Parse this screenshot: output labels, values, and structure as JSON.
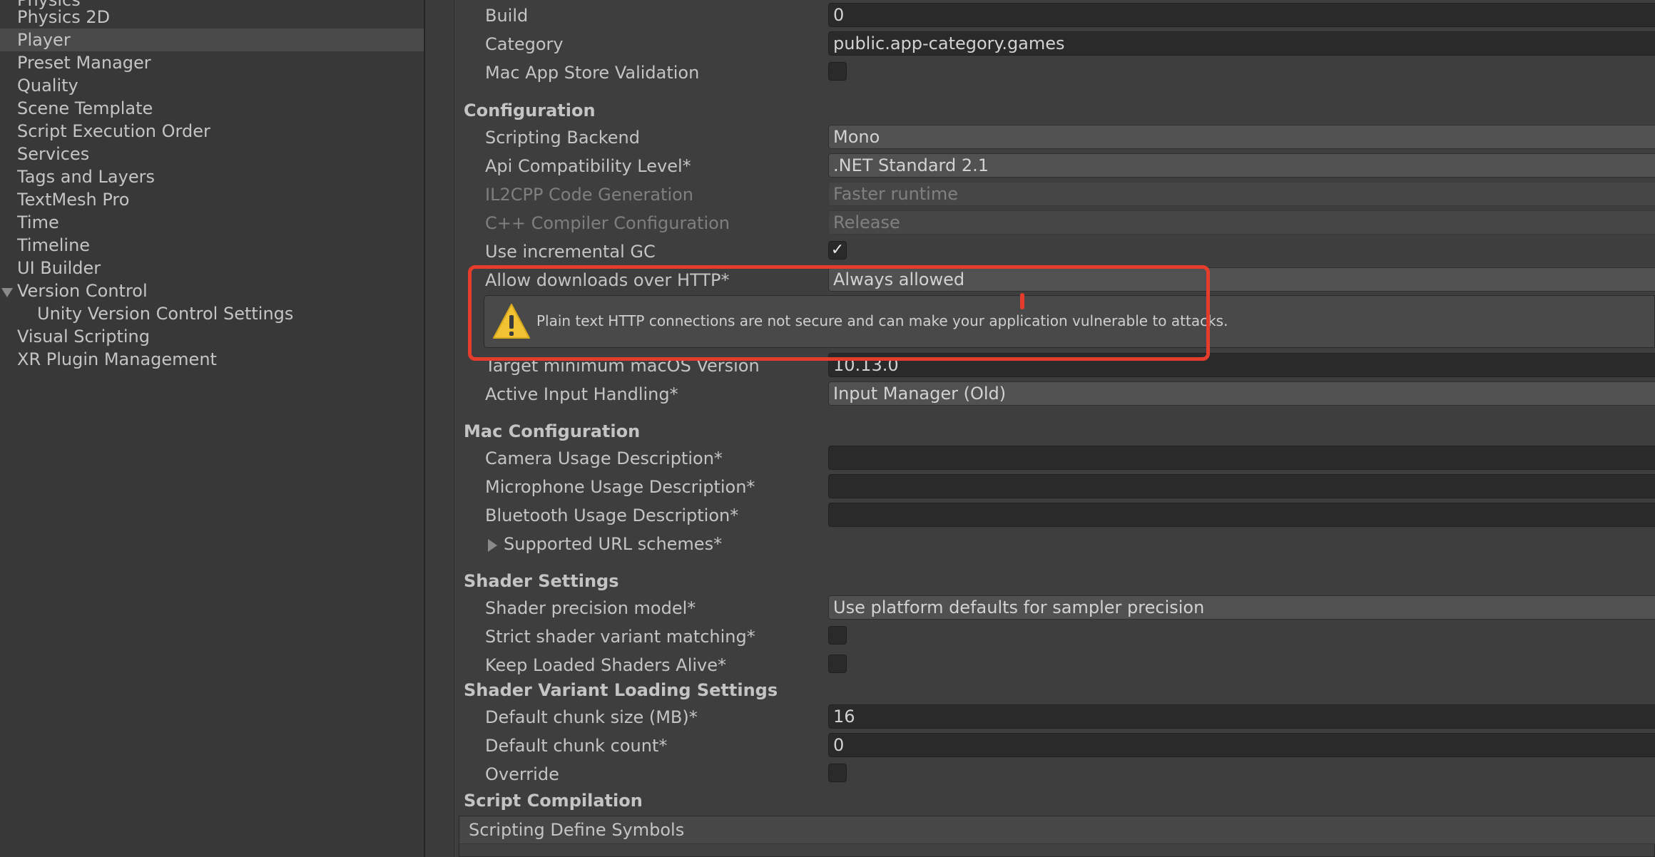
{
  "colors": {
    "highlight": "#e53c2c",
    "warning": "#f1c232",
    "selected_bg": "#4a4a4a"
  },
  "sidebar": {
    "items": [
      {
        "label": "Physics",
        "indent": 0
      },
      {
        "label": "Physics 2D",
        "indent": 0
      },
      {
        "label": "Player",
        "indent": 0,
        "selected": true
      },
      {
        "label": "Preset Manager",
        "indent": 0
      },
      {
        "label": "Quality",
        "indent": 0
      },
      {
        "label": "Scene Template",
        "indent": 0
      },
      {
        "label": "Script Execution Order",
        "indent": 0
      },
      {
        "label": "Services",
        "indent": 0
      },
      {
        "label": "Tags and Layers",
        "indent": 0
      },
      {
        "label": "TextMesh Pro",
        "indent": 0
      },
      {
        "label": "Time",
        "indent": 0
      },
      {
        "label": "Timeline",
        "indent": 0
      },
      {
        "label": "UI Builder",
        "indent": 0
      },
      {
        "label": "Version Control",
        "indent": 0,
        "expanded": true
      },
      {
        "label": "Unity Version Control Settings",
        "indent": 1
      },
      {
        "label": "Visual Scripting",
        "indent": 0
      },
      {
        "label": "XR Plugin Management",
        "indent": 0
      }
    ]
  },
  "inspector": {
    "build": {
      "label": "Build",
      "value": "0"
    },
    "category": {
      "label": "Category",
      "value": "public.app-category.games"
    },
    "mac_app_store_validation": {
      "label": "Mac App Store Validation",
      "checked": false
    },
    "configuration_header": "Configuration",
    "scripting_backend": {
      "label": "Scripting Backend",
      "value": "Mono"
    },
    "api_compat": {
      "label": "Api Compatibility Level*",
      "value": ".NET Standard 2.1"
    },
    "il2cpp_codegen": {
      "label": "IL2CPP Code Generation",
      "value": "Faster runtime"
    },
    "cpp_compiler": {
      "label": "C++ Compiler Configuration",
      "value": "Release"
    },
    "incremental_gc": {
      "label": "Use incremental GC",
      "checked": true,
      "mark": "✓"
    },
    "allow_http": {
      "label": "Allow downloads over HTTP*",
      "value": "Always allowed"
    },
    "http_warning": "Plain text HTTP connections are not secure and can make your application vulnerable to attacks.",
    "min_macos": {
      "label": "Target minimum macOS Version",
      "value": "10.13.0"
    },
    "active_input": {
      "label": "Active Input Handling*",
      "value": "Input Manager (Old)"
    },
    "mac_configuration_header": "Mac Configuration",
    "camera_usage": {
      "label": "Camera Usage Description*",
      "value": ""
    },
    "microphone_usage": {
      "label": "Microphone Usage Description*",
      "value": ""
    },
    "bluetooth_usage": {
      "label": "Bluetooth Usage Description*",
      "value": ""
    },
    "url_schemes": {
      "label": "Supported URL schemes*"
    },
    "shader_settings_header": "Shader Settings",
    "shader_precision": {
      "label": "Shader precision model*",
      "value": "Use platform defaults for sampler precision"
    },
    "strict_shader": {
      "label": "Strict shader variant matching*",
      "checked": false
    },
    "keep_shaders": {
      "label": "Keep Loaded Shaders Alive*",
      "checked": false
    },
    "shader_variant_header": "Shader Variant Loading Settings",
    "chunk_size": {
      "label": "Default chunk size (MB)*",
      "value": "16"
    },
    "chunk_count": {
      "label": "Default chunk count*",
      "value": "0"
    },
    "override": {
      "label": "Override",
      "checked": false
    },
    "script_compilation_header": "Script Compilation",
    "scripting_define_symbols": "Scripting Define Symbols"
  }
}
